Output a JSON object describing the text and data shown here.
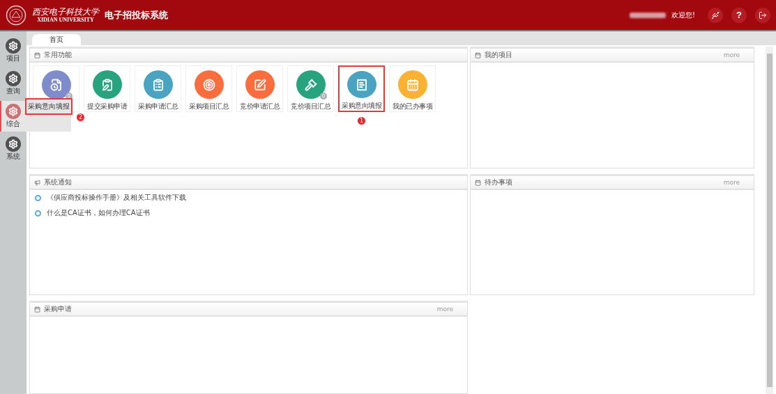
{
  "header": {
    "university_cn": "西安电子科技大学",
    "university_en": "XIDIAN UNIVERSITY",
    "system_title": "电子招投标系统",
    "welcome": "欢迎您!",
    "help": "?"
  },
  "tabs": [
    {
      "label": "首页",
      "selected": true
    }
  ],
  "sidebar": {
    "items": [
      {
        "label": "项目",
        "selected": false
      },
      {
        "label": "查询",
        "selected": false
      },
      {
        "label": "综合",
        "selected": true
      },
      {
        "label": "系统",
        "selected": false
      }
    ],
    "flyout": {
      "label": "采购意向填报",
      "highlighted": true,
      "step": "2"
    }
  },
  "panels": [
    {
      "kind": "tiles",
      "title": "常用功能",
      "tiles": [
        {
          "color": "#7e8ccb",
          "count": "0",
          "highlighted": false
        },
        {
          "label": "提交采购申请",
          "color": "#27a37d",
          "highlighted": false
        },
        {
          "label": "采购申请汇总",
          "color": "#4aa3c0",
          "highlighted": false
        },
        {
          "label": "采购项目汇总",
          "color": "#fb6d3c",
          "highlighted": false
        },
        {
          "label": "竞价申请汇总",
          "color": "#fb6d3c",
          "highlighted": false
        },
        {
          "label": "竞价项目汇总",
          "color": "#27a37d",
          "count": "0",
          "highlighted": false
        },
        {
          "label": "采购意向填报",
          "color": "#4aa3c0",
          "highlighted": true,
          "step": "1"
        },
        {
          "label": "我的已办事项",
          "color": "#fbb233",
          "highlighted": false
        }
      ]
    },
    {
      "kind": "list",
      "title": "我的项目",
      "more": "more"
    },
    {
      "kind": "notices",
      "title": "系统通知",
      "notices": [
        "《供应商投标操作手册》及相关工具软件下载",
        "什么是CA证书，如何办理CA证书"
      ]
    },
    {
      "kind": "list",
      "title": "待办事项",
      "more": "more"
    },
    {
      "kind": "list",
      "title": "采购申请",
      "more": "more"
    }
  ]
}
